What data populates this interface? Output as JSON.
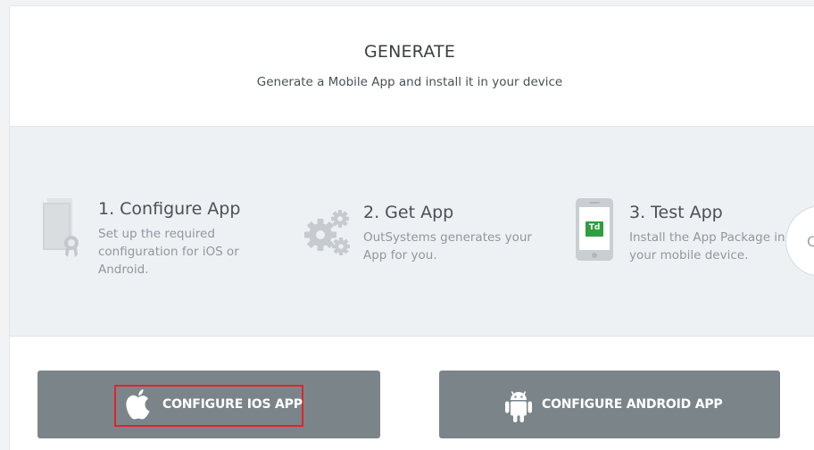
{
  "header": {
    "title": "GENERATE",
    "subtitle": "Generate a Mobile App and install it in your device"
  },
  "steps": [
    {
      "title": "1. Configure App",
      "description": [
        "Set up the required",
        "configuration for iOS or",
        "Android."
      ],
      "icon": "certificate-document-icon"
    },
    {
      "title": "2. Get App",
      "description": [
        "OutSystems generates your",
        "App for you."
      ],
      "icon": "gears-icon"
    },
    {
      "title": "3. Test App",
      "description": [
        "Install the App Package in",
        "your mobile device."
      ],
      "icon": "mobile-phone-icon",
      "phone_badge": "Td"
    }
  ],
  "carousel_next": {
    "label": "C"
  },
  "buttons": {
    "ios": {
      "label": "CONFIGURE IOS APP",
      "icon": "apple-icon"
    },
    "android": {
      "label": "CONFIGURE ANDROID APP",
      "icon": "android-icon"
    }
  },
  "colors": {
    "button_bg": "#7b8589",
    "steps_bg": "#eef1f4",
    "highlight": "#e0242b",
    "badge_green": "#2e9e3e"
  }
}
